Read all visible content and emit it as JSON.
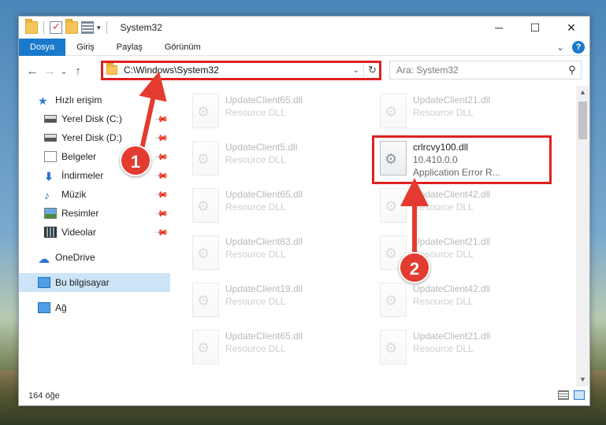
{
  "window": {
    "title": "System32",
    "controls": {
      "minimize": "─",
      "maximize": "☐",
      "close": "✕"
    }
  },
  "ribbon": {
    "tabs": [
      {
        "label": "Dosya",
        "active": true
      },
      {
        "label": "Giriş"
      },
      {
        "label": "Paylaş"
      },
      {
        "label": "Görünüm"
      }
    ],
    "expand_glyph": "⌄",
    "help_glyph": "?"
  },
  "nav_buttons": {
    "back": "←",
    "forward": "→",
    "recent": "⌄",
    "up": "↑"
  },
  "address": {
    "path": "C:\\Windows\\System32",
    "dropdown": "⌄",
    "refresh": "↻"
  },
  "search": {
    "placeholder": "Ara: System32",
    "icon": "search-icon"
  },
  "sidebar": {
    "quick_access": "Hızlı erişim",
    "items": [
      {
        "label": "Yerel Disk (C:)",
        "icon": "disk-icon",
        "pinned": true
      },
      {
        "label": "Yerel Disk (D:)",
        "icon": "disk-icon",
        "pinned": true
      },
      {
        "label": "Belgeler",
        "icon": "documents-icon",
        "pinned": true
      },
      {
        "label": "İndirmeler",
        "icon": "downloads-icon",
        "pinned": true
      },
      {
        "label": "Müzik",
        "icon": "music-icon",
        "pinned": true
      },
      {
        "label": "Resimler",
        "icon": "pictures-icon",
        "pinned": true
      },
      {
        "label": "Videolar",
        "icon": "videos-icon",
        "pinned": true
      }
    ],
    "onedrive": "OneDrive",
    "this_pc": "Bu bilgisayar",
    "network": "Ağ"
  },
  "files": {
    "col1": [
      {
        "name": "UpdateClient65.dll",
        "type": "Resource DLL"
      },
      {
        "name": "UpdateClient5.dll",
        "type": "Resource DLL"
      },
      {
        "name": "UpdateClient65.dll",
        "type": "Resource DLL"
      },
      {
        "name": "UpdateClient63.dll",
        "type": "Resource DLL"
      },
      {
        "name": "UpdateClient19.dll",
        "type": "Resource DLL"
      },
      {
        "name": "UpdateClient65.dll",
        "type": "Resource DLL"
      }
    ],
    "col2_top": {
      "name": "UpdateClient21.dll",
      "type": "Resource DLL"
    },
    "selected": {
      "name": "crlrcvy100.dll",
      "version": "10.410.0.0",
      "type": "Application Error R..."
    },
    "col2_rest": [
      {
        "name": "UpdateClient42.dll",
        "type": "Resource DLL"
      },
      {
        "name": "UpdateClient21.dll",
        "type": "Resource DLL"
      },
      {
        "name": "UpdateClient42.dll",
        "type": "Resource DLL"
      },
      {
        "name": "UpdateClient21.dll",
        "type": "Resource DLL"
      }
    ]
  },
  "status": {
    "count": "164 öğe"
  },
  "annotations": {
    "step1": "1",
    "step2": "2",
    "color": "#e02020"
  }
}
